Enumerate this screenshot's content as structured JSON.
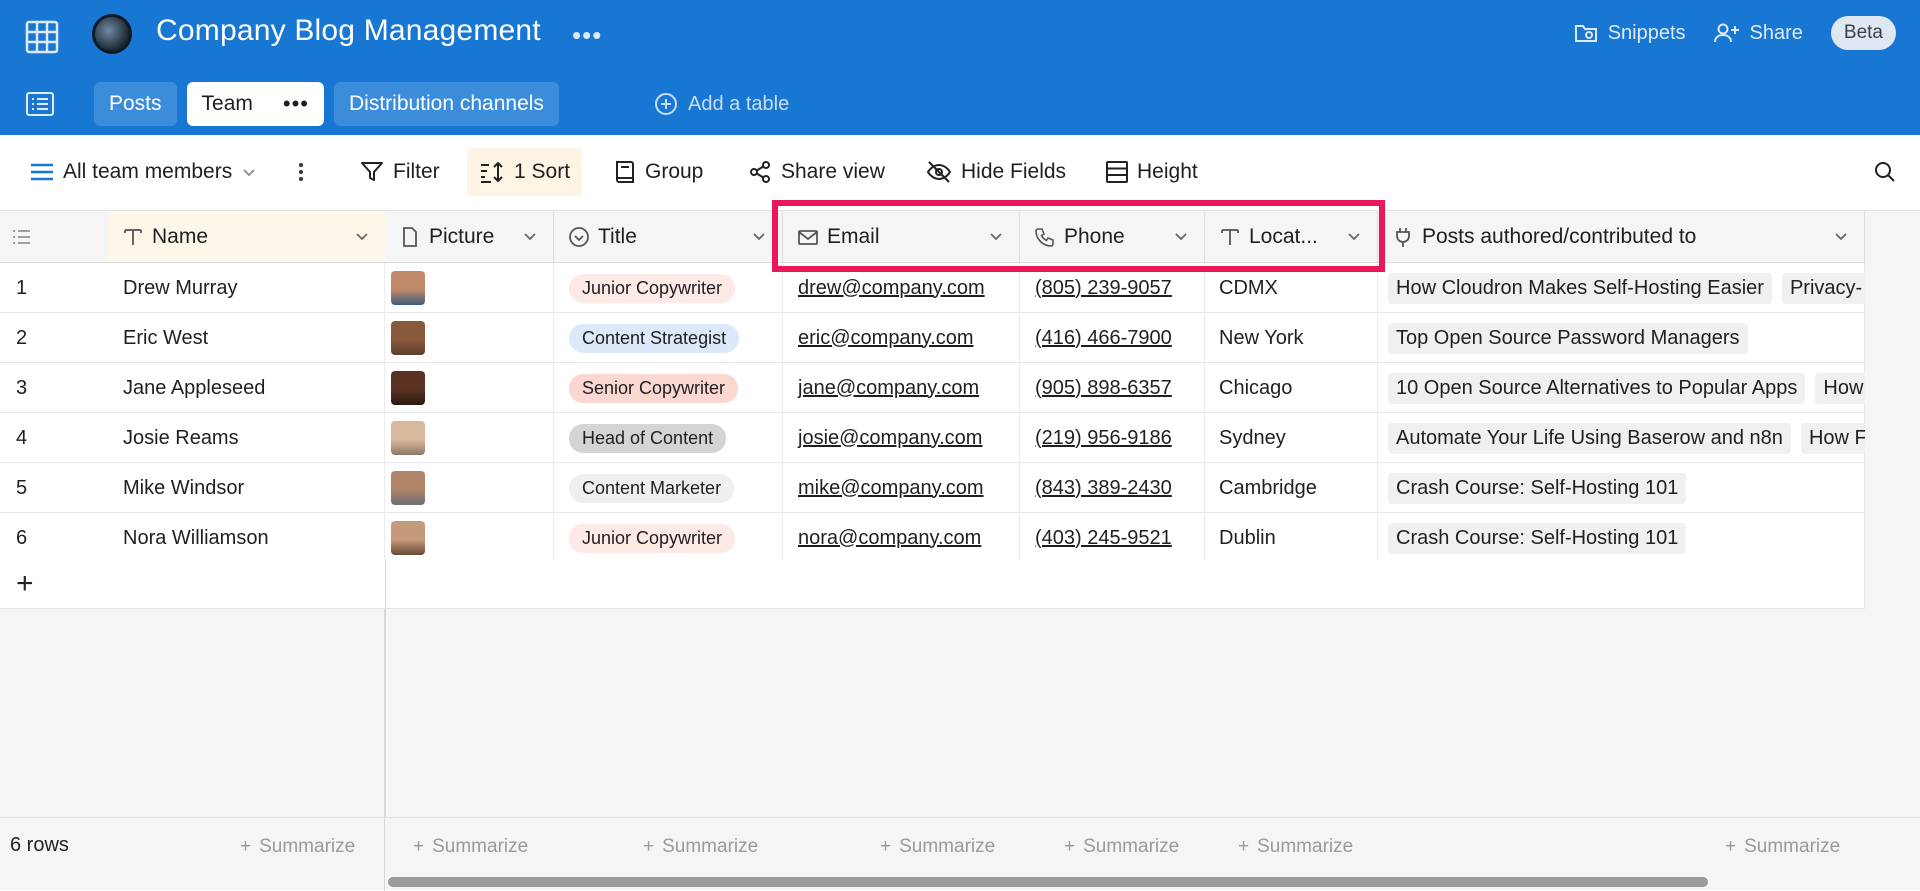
{
  "app": {
    "title": "Company Blog Management",
    "more": "•••"
  },
  "topright": {
    "snippets": "Snippets",
    "share": "Share",
    "beta": "Beta"
  },
  "tabs": [
    {
      "label": "Posts"
    },
    {
      "label": "Team",
      "more": "•••"
    },
    {
      "label": "Distribution channels"
    }
  ],
  "add_table": "Add a table",
  "toolbar": {
    "view": "All team members",
    "filter": "Filter",
    "sort": "1 Sort",
    "group": "Group",
    "share_view": "Share view",
    "hide_fields": "Hide Fields",
    "height": "Height"
  },
  "columns": {
    "name": "Name",
    "picture": "Picture",
    "title": "Title",
    "email": "Email",
    "phone": "Phone",
    "location": "Locat...",
    "posts": "Posts authored/contributed to"
  },
  "rows": [
    {
      "id": "1",
      "name": "Drew Murray",
      "title": "Junior Copywriter",
      "title_color": "#fde9e6",
      "email": "drew@company.com",
      "phone": "(805) 239-9057",
      "location": "CDMX",
      "posts": [
        "How Cloudron Makes Self-Hosting Easier",
        "Privacy-"
      ]
    },
    {
      "id": "2",
      "name": "Eric West",
      "title": "Content Strategist",
      "title_color": "#dde8fb",
      "email": "eric@company.com",
      "phone": "(416) 466-7900",
      "location": "New York",
      "posts": [
        "Top Open Source Password Managers"
      ]
    },
    {
      "id": "3",
      "name": "Jane Appleseed",
      "title": "Senior Copywriter",
      "title_color": "#fbd7d2",
      "email": "jane@company.com",
      "phone": "(905) 898-6357",
      "location": "Chicago",
      "posts": [
        "10 Open Source Alternatives to Popular Apps",
        "How"
      ]
    },
    {
      "id": "4",
      "name": "Josie Reams",
      "title": "Head of Content",
      "title_color": "#d4d4d4",
      "email": "josie@company.com",
      "phone": "(219) 956-9186",
      "location": "Sydney",
      "posts": [
        "Automate Your Life Using Baserow and n8n",
        "How F"
      ]
    },
    {
      "id": "5",
      "name": "Mike Windsor",
      "title": "Content Marketer",
      "title_color": "#efefef",
      "email": "mike@company.com",
      "phone": "(843) 389-2430",
      "location": "Cambridge",
      "posts": [
        "Crash Course: Self-Hosting 101"
      ]
    },
    {
      "id": "6",
      "name": "Nora Williamson",
      "title": "Junior Copywriter",
      "title_color": "#fde9e6",
      "email": "nora@company.com",
      "phone": "(403) 245-9521",
      "location": "Dublin",
      "posts": [
        "Crash Course: Self-Hosting 101"
      ]
    }
  ],
  "add_row": "+",
  "footer": {
    "row_count": "6 rows",
    "summarize": "Summarize"
  },
  "colors": {
    "brand": "#1877d2",
    "highlight": "#e8185a"
  }
}
